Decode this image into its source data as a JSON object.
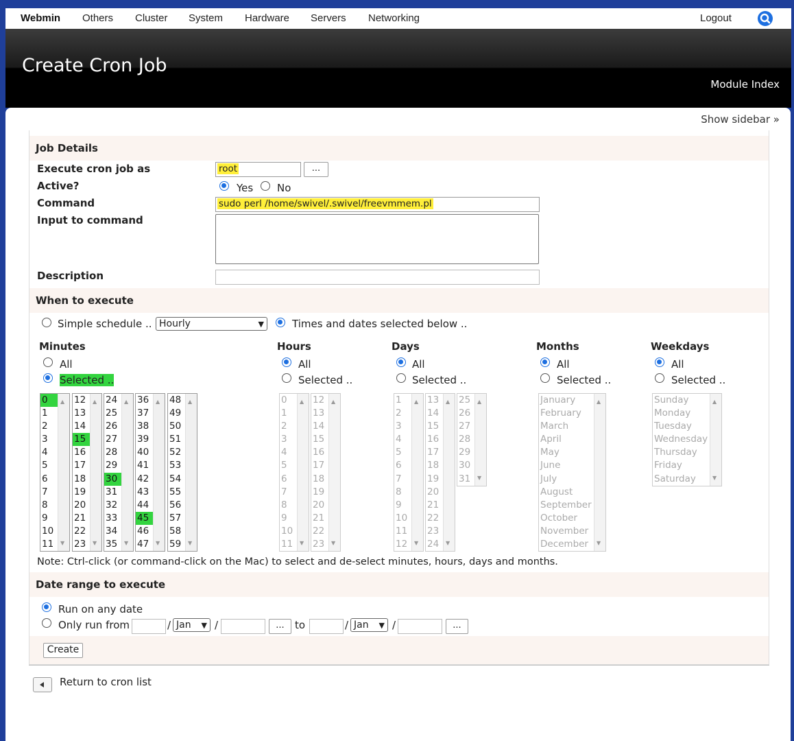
{
  "topnav": {
    "brand": "Webmin",
    "items": [
      "Others",
      "Cluster",
      "System",
      "Hardware",
      "Servers",
      "Networking"
    ],
    "logout": "Logout",
    "search_icon": "search-icon"
  },
  "header": {
    "title": "Create Cron Job",
    "module_index": "Module Index"
  },
  "show_sidebar": "Show sidebar »",
  "job_details": {
    "heading": "Job Details",
    "execute_as_label": "Execute cron job as",
    "execute_as_value": "root",
    "picker_button": "...",
    "active_label": "Active?",
    "active_yes": "Yes",
    "active_no": "No",
    "active_selected": "Yes",
    "command_label": "Command",
    "command_value": "sudo perl /home/swivel/.swivel/freevmmem.pl",
    "input_label": "Input to command",
    "input_value": "",
    "description_label": "Description",
    "description_value": ""
  },
  "when": {
    "heading": "When to execute",
    "simple_label": "Simple schedule ..",
    "simple_value": "Hourly",
    "times_label": "Times and dates selected below ..",
    "mode_selected": "times",
    "all_label": "All",
    "selected_label": "Selected ..",
    "minutes_title": "Minutes",
    "hours_title": "Hours",
    "days_title": "Days",
    "months_title": "Months",
    "weekdays_title": "Weekdays",
    "minutes_mode": "selected",
    "hours_mode": "all",
    "days_mode": "all",
    "months_mode": "all",
    "weekdays_mode": "all",
    "minutes_selected": [
      "0",
      "15",
      "30",
      "45"
    ],
    "minutes_columns": [
      [
        "0",
        "1",
        "2",
        "3",
        "4",
        "5",
        "6",
        "7",
        "8",
        "9",
        "10",
        "11"
      ],
      [
        "12",
        "13",
        "14",
        "15",
        "16",
        "17",
        "18",
        "19",
        "20",
        "21",
        "22",
        "23"
      ],
      [
        "24",
        "25",
        "26",
        "27",
        "28",
        "29",
        "30",
        "31",
        "32",
        "33",
        "34",
        "35"
      ],
      [
        "36",
        "37",
        "38",
        "39",
        "40",
        "41",
        "42",
        "43",
        "44",
        "45",
        "46",
        "47"
      ],
      [
        "48",
        "49",
        "50",
        "51",
        "52",
        "53",
        "54",
        "55",
        "56",
        "57",
        "58",
        "59"
      ]
    ],
    "hours_columns": [
      [
        "0",
        "1",
        "2",
        "3",
        "4",
        "5",
        "6",
        "7",
        "8",
        "9",
        "10",
        "11"
      ],
      [
        "12",
        "13",
        "14",
        "15",
        "16",
        "17",
        "18",
        "19",
        "20",
        "21",
        "22",
        "23"
      ]
    ],
    "days_columns": [
      [
        "1",
        "2",
        "3",
        "4",
        "5",
        "6",
        "7",
        "8",
        "9",
        "10",
        "11",
        "12"
      ],
      [
        "13",
        "14",
        "15",
        "16",
        "17",
        "18",
        "19",
        "20",
        "21",
        "22",
        "23",
        "24"
      ],
      [
        "25",
        "26",
        "27",
        "28",
        "29",
        "30",
        "31"
      ]
    ],
    "months": [
      "January",
      "February",
      "March",
      "April",
      "May",
      "June",
      "July",
      "August",
      "September",
      "October",
      "November",
      "December"
    ],
    "weekdays": [
      "Sunday",
      "Monday",
      "Tuesday",
      "Wednesday",
      "Thursday",
      "Friday",
      "Saturday"
    ],
    "note": "Note: Ctrl-click (or command-click on the Mac) to select and de-select minutes, hours, days and months."
  },
  "date_range": {
    "heading": "Date range to execute",
    "any_label": "Run on any date",
    "only_label": "Only run from",
    "selected": "any",
    "from_month": "Jan",
    "to_label": "to",
    "to_month": "Jan",
    "slash": "/",
    "picker_button": "..."
  },
  "create_button": "Create",
  "return_link": "Return to cron list",
  "colors": {
    "accent": "#1d6fe0",
    "highlight_yellow": "#ffef3a",
    "highlight_green": "#33d43f",
    "frame": "#1f3f9a"
  }
}
